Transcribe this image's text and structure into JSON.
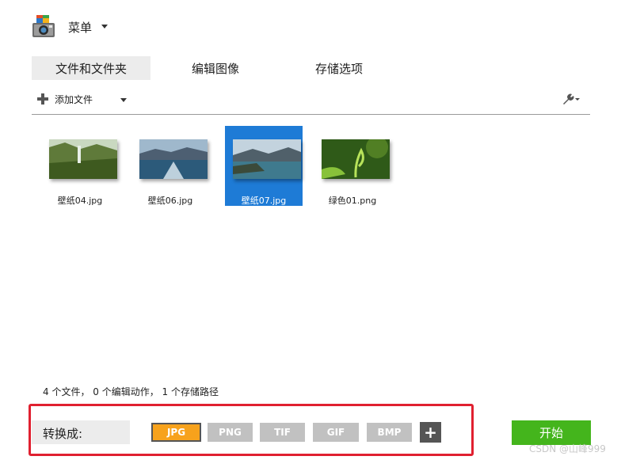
{
  "app": {
    "menu_label": "菜单"
  },
  "tabs": [
    {
      "label": "文件和文件夹",
      "active": true
    },
    {
      "label": "编辑图像",
      "active": false
    },
    {
      "label": "存储选项",
      "active": false
    }
  ],
  "toolbar": {
    "add_file_label": "添加文件",
    "settings_icon": "wrench-icon"
  },
  "files": [
    {
      "name": "壁纸04.jpg",
      "selected": false
    },
    {
      "name": "壁纸06.jpg",
      "selected": false
    },
    {
      "name": "壁纸07.jpg",
      "selected": true
    },
    {
      "name": "绿色01.png",
      "selected": false
    }
  ],
  "status_text": "4 个文件， 0 个编辑动作， 1 个存储路径",
  "convert": {
    "label": "转换成:",
    "formats": [
      "JPG",
      "PNG",
      "TIF",
      "GIF",
      "BMP"
    ],
    "active_format": "JPG",
    "add_label": "+"
  },
  "start_label": "开始",
  "watermark": "CSDN @山峰999",
  "colors": {
    "accent_orange": "#f7a21c",
    "start_green": "#44b51c",
    "selection_blue": "#1e7bd6",
    "highlight_red": "#e02030"
  }
}
